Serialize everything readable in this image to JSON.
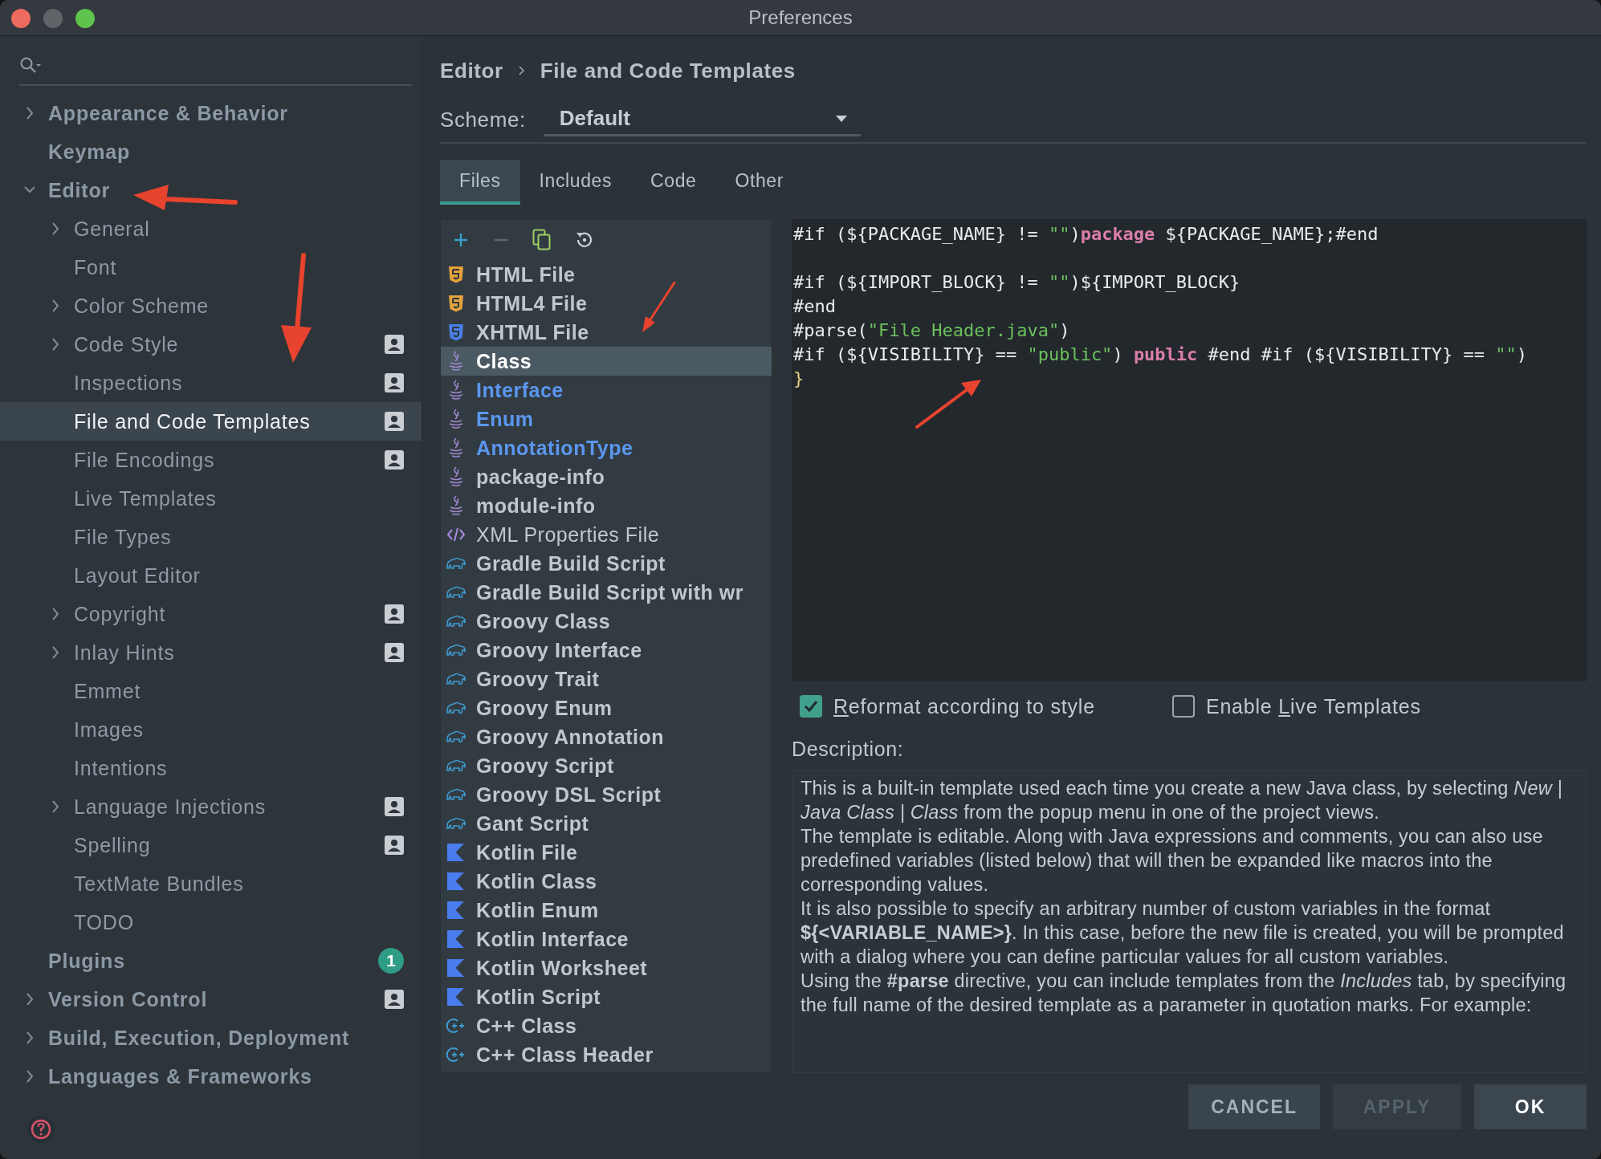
{
  "window": {
    "title": "Preferences"
  },
  "sidebar": {
    "items": [
      {
        "label": "Appearance & Behavior",
        "expanded": false,
        "selected": false,
        "project_level": false
      },
      {
        "label": "Keymap",
        "selected": false,
        "project_level": false
      },
      {
        "label": "Editor",
        "expanded": true,
        "selected": false,
        "project_level": false,
        "children": [
          {
            "label": "General",
            "expanded": false,
            "selected": false,
            "project_level": false
          },
          {
            "label": "Font",
            "selected": false,
            "project_level": false
          },
          {
            "label": "Color Scheme",
            "expanded": false,
            "selected": false,
            "project_level": false
          },
          {
            "label": "Code Style",
            "expanded": false,
            "selected": false,
            "project_level": true
          },
          {
            "label": "Inspections",
            "selected": false,
            "project_level": true
          },
          {
            "label": "File and Code Templates",
            "selected": true,
            "project_level": true
          },
          {
            "label": "File Encodings",
            "selected": false,
            "project_level": true
          },
          {
            "label": "Live Templates",
            "selected": false,
            "project_level": false
          },
          {
            "label": "File Types",
            "selected": false,
            "project_level": false
          },
          {
            "label": "Layout Editor",
            "selected": false,
            "project_level": false
          },
          {
            "label": "Copyright",
            "expanded": false,
            "selected": false,
            "project_level": true
          },
          {
            "label": "Inlay Hints",
            "expanded": false,
            "selected": false,
            "project_level": true
          },
          {
            "label": "Emmet",
            "selected": false,
            "project_level": false
          },
          {
            "label": "Images",
            "selected": false,
            "project_level": false
          },
          {
            "label": "Intentions",
            "selected": false,
            "project_level": false
          },
          {
            "label": "Language Injections",
            "expanded": false,
            "selected": false,
            "project_level": true
          },
          {
            "label": "Spelling",
            "selected": false,
            "project_level": true
          },
          {
            "label": "TextMate Bundles",
            "selected": false,
            "project_level": false
          },
          {
            "label": "TODO",
            "selected": false,
            "project_level": false
          }
        ]
      },
      {
        "label": "Plugins",
        "selected": false,
        "project_level": false,
        "badge": "1"
      },
      {
        "label": "Version Control",
        "expanded": false,
        "selected": false,
        "project_level": true
      },
      {
        "label": "Build, Execution, Deployment",
        "expanded": false,
        "selected": false,
        "project_level": false
      },
      {
        "label": "Languages & Frameworks",
        "expanded": false,
        "selected": false,
        "project_level": false
      }
    ]
  },
  "breadcrumb": [
    "Editor",
    "File and Code Templates"
  ],
  "scheme": {
    "label": "Scheme:",
    "value": "Default"
  },
  "tabs": [
    {
      "label": "Files",
      "selected": true
    },
    {
      "label": "Includes",
      "selected": false
    },
    {
      "label": "Code",
      "selected": false
    },
    {
      "label": "Other",
      "selected": false
    }
  ],
  "templates": [
    {
      "name": "HTML File",
      "kind": "html",
      "bold": true,
      "modified": false,
      "selected": false
    },
    {
      "name": "HTML4 File",
      "kind": "html",
      "bold": true,
      "modified": false,
      "selected": false
    },
    {
      "name": "XHTML File",
      "kind": "xhtml",
      "bold": true,
      "modified": false,
      "selected": false
    },
    {
      "name": "Class",
      "kind": "java",
      "bold": true,
      "modified": false,
      "selected": true
    },
    {
      "name": "Interface",
      "kind": "java",
      "bold": true,
      "modified": true,
      "selected": false
    },
    {
      "name": "Enum",
      "kind": "java",
      "bold": true,
      "modified": true,
      "selected": false
    },
    {
      "name": "AnnotationType",
      "kind": "java",
      "bold": true,
      "modified": true,
      "selected": false
    },
    {
      "name": "package-info",
      "kind": "java",
      "bold": true,
      "modified": false,
      "selected": false
    },
    {
      "name": "module-info",
      "kind": "java",
      "bold": true,
      "modified": false,
      "selected": false
    },
    {
      "name": "XML Properties File",
      "kind": "xml",
      "bold": false,
      "modified": false,
      "selected": false
    },
    {
      "name": "Gradle Build Script",
      "kind": "gradle",
      "bold": true,
      "modified": false,
      "selected": false
    },
    {
      "name": "Gradle Build Script with wr",
      "kind": "gradle",
      "bold": true,
      "modified": false,
      "selected": false
    },
    {
      "name": "Groovy Class",
      "kind": "gradle",
      "bold": true,
      "modified": false,
      "selected": false
    },
    {
      "name": "Groovy Interface",
      "kind": "gradle",
      "bold": true,
      "modified": false,
      "selected": false
    },
    {
      "name": "Groovy Trait",
      "kind": "gradle",
      "bold": true,
      "modified": false,
      "selected": false
    },
    {
      "name": "Groovy Enum",
      "kind": "gradle",
      "bold": true,
      "modified": false,
      "selected": false
    },
    {
      "name": "Groovy Annotation",
      "kind": "gradle",
      "bold": true,
      "modified": false,
      "selected": false
    },
    {
      "name": "Groovy Script",
      "kind": "gradle",
      "bold": true,
      "modified": false,
      "selected": false
    },
    {
      "name": "Groovy DSL Script",
      "kind": "gradle",
      "bold": true,
      "modified": false,
      "selected": false
    },
    {
      "name": "Gant Script",
      "kind": "gradle",
      "bold": true,
      "modified": false,
      "selected": false
    },
    {
      "name": "Kotlin File",
      "kind": "kotlin",
      "bold": true,
      "modified": false,
      "selected": false
    },
    {
      "name": "Kotlin Class",
      "kind": "kotlin",
      "bold": true,
      "modified": false,
      "selected": false
    },
    {
      "name": "Kotlin Enum",
      "kind": "kotlin",
      "bold": true,
      "modified": false,
      "selected": false
    },
    {
      "name": "Kotlin Interface",
      "kind": "kotlin",
      "bold": true,
      "modified": false,
      "selected": false
    },
    {
      "name": "Kotlin Worksheet",
      "kind": "kotlin",
      "bold": true,
      "modified": false,
      "selected": false
    },
    {
      "name": "Kotlin Script",
      "kind": "kotlin",
      "bold": true,
      "modified": false,
      "selected": false
    },
    {
      "name": "C++ Class",
      "kind": "cpp",
      "bold": true,
      "modified": false,
      "selected": false
    },
    {
      "name": "C++ Class Header",
      "kind": "cpp",
      "bold": true,
      "modified": false,
      "selected": false
    }
  ],
  "code_lines": [
    {
      "kind": "code",
      "tokens": [
        {
          "text": "#if (${PACKAGE_NAME} != ",
          "kind": "plain"
        },
        {
          "text": "\"\"",
          "kind": "string"
        },
        {
          "text": ")",
          "kind": "plain"
        },
        {
          "text": "package",
          "kind": "keyword"
        },
        {
          "text": " ${PACKAGE_NAME};#end",
          "kind": "plain"
        }
      ]
    },
    {
      "kind": "blank"
    },
    {
      "kind": "code",
      "tokens": [
        {
          "text": "#if (${IMPORT_BLOCK} != ",
          "kind": "plain"
        },
        {
          "text": "\"\"",
          "kind": "string"
        },
        {
          "text": ")${IMPORT_BLOCK}",
          "kind": "plain"
        }
      ]
    },
    {
      "kind": "code",
      "tokens": [
        {
          "text": "#end",
          "kind": "plain"
        }
      ]
    },
    {
      "kind": "code",
      "tokens": [
        {
          "text": "#parse(",
          "kind": "plain"
        },
        {
          "text": "\"File Header.java\"",
          "kind": "string"
        },
        {
          "text": ")",
          "kind": "plain"
        }
      ]
    },
    {
      "kind": "code",
      "tokens": [
        {
          "text": "#if (${VISIBILITY} == ",
          "kind": "plain"
        },
        {
          "text": "\"public\"",
          "kind": "string"
        },
        {
          "text": ") ",
          "kind": "plain"
        },
        {
          "text": "public",
          "kind": "keyword"
        },
        {
          "text": " #end #if (${VISIBILITY} == ",
          "kind": "plain"
        },
        {
          "text": "\"\"",
          "kind": "string"
        },
        {
          "text": ")",
          "kind": "plain"
        }
      ]
    },
    {
      "kind": "code",
      "tokens": [
        {
          "text": "}",
          "kind": "brace"
        }
      ]
    }
  ],
  "options": [
    {
      "mnemonic": "R",
      "rest": "eformat according to style",
      "checked": true
    },
    {
      "before": "Enable ",
      "mnemonic": "L",
      "rest": "ive Templates",
      "checked": false
    }
  ],
  "description": {
    "label": "Description:",
    "paragraphs": [
      "This is a built-in template used each time you create a new Java class, by selecting *New | Java Class | Class* from the popup menu in one of the project views.",
      "The template is editable. Along with Java expressions and comments, you can also use predefined variables (listed below) that will then be expanded like macros into the corresponding values.",
      "It is also possible to specify an arbitrary number of custom variables in the format **${<VARIABLE_NAME>}**. In this case, before the new file is created, you will be prompted with a dialog where you can define particular values for all custom variables.",
      "Using the **#parse** directive, you can include templates from the *Includes* tab, by specifying the full name of the desired template as a parameter in quotation marks. For example:"
    ]
  },
  "buttons": [
    {
      "label": "CANCEL",
      "disabled": false,
      "default": false
    },
    {
      "label": "APPLY",
      "disabled": true,
      "default": false
    },
    {
      "label": "OK",
      "disabled": false,
      "default": true
    }
  ]
}
